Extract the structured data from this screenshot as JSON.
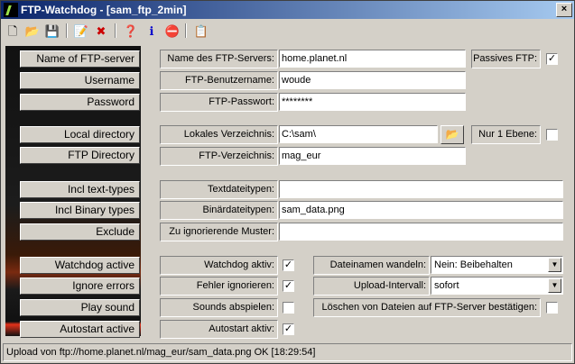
{
  "window": {
    "title": "FTP-Watchdog - [sam_ftp_2min]",
    "close_glyph": "×"
  },
  "toolbar": [
    {
      "name": "new-icon",
      "glyph": "🗋"
    },
    {
      "name": "open-folder-icon",
      "glyph": "📂"
    },
    {
      "name": "save-icon",
      "glyph": "💾"
    },
    {
      "name": "edit-icon",
      "glyph": "📝"
    },
    {
      "name": "delete-icon",
      "glyph": "✖"
    },
    {
      "name": "help-icon",
      "glyph": "❓"
    },
    {
      "name": "info-icon",
      "glyph": "ℹ"
    },
    {
      "name": "stop-icon",
      "glyph": "⛔"
    },
    {
      "name": "properties-icon",
      "glyph": "📋"
    }
  ],
  "left_buttons": [
    "Name of FTP-server",
    "Username",
    "Password",
    "Local directory",
    "FTP Directory",
    "Incl text-types",
    "Incl Binary types",
    "Exclude",
    "Watchdog active",
    "Ignore errors",
    "Play sound",
    "Autostart active"
  ],
  "fields": {
    "server": {
      "label": "Name des FTP-Servers:",
      "value": "home.planet.nl"
    },
    "passive": {
      "label": "Passives FTP:",
      "checked": "✓"
    },
    "user": {
      "label": "FTP-Benutzername:",
      "value": "woude"
    },
    "password": {
      "label": "FTP-Passwort:",
      "value": "********"
    },
    "localdir": {
      "label": "Lokales Verzeichnis:",
      "value": "C:\\sam\\",
      "folder_glyph": "📂"
    },
    "onelevel": {
      "label": "Nur 1 Ebene:",
      "checked": ""
    },
    "ftpdir": {
      "label": "FTP-Verzeichnis:",
      "value": "mag_eur"
    },
    "texttypes": {
      "label": "Textdateitypen:",
      "value": ""
    },
    "bintypes": {
      "label": "Binärdateitypen:",
      "value": "sam_data.png"
    },
    "exclude": {
      "label": "Zu ignorierende Muster:",
      "value": ""
    },
    "watchdog": {
      "label": "Watchdog aktiv:",
      "checked": "✓"
    },
    "ignore": {
      "label": "Fehler ignorieren:",
      "checked": "✓"
    },
    "sounds": {
      "label": "Sounds abspielen:",
      "checked": ""
    },
    "autostart": {
      "label": "Autostart aktiv:",
      "checked": "✓"
    },
    "rename": {
      "label": "Dateinamen wandeln:",
      "value": "Nein: Beibehalten"
    },
    "interval": {
      "label": "Upload-Intervall:",
      "value": "sofort"
    },
    "confirmdelete": {
      "label": "Löschen von Dateien auf FTP-Server bestätigen:",
      "checked": ""
    }
  },
  "dropdown_glyph": "▼",
  "status": "Upload von ftp://home.planet.nl/mag_eur/sam_data.png OK [18:29:54]"
}
